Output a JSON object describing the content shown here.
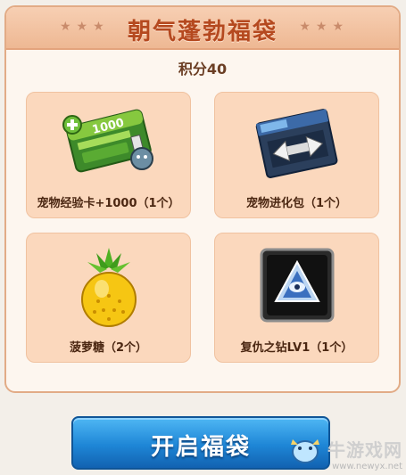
{
  "header": {
    "title": "朝气蓬勃福袋",
    "stars": "★★★"
  },
  "points_label": "积分40",
  "rewards": [
    {
      "label": "宠物经验卡+1000（1个）",
      "icon": "pet-exp-card-icon"
    },
    {
      "label": "宠物进化包（1个）",
      "icon": "pet-evolution-pack-icon"
    },
    {
      "label": "菠萝糖（2个）",
      "icon": "pineapple-candy-icon"
    },
    {
      "label": "复仇之钻LV1（1个）",
      "icon": "revenge-diamond-icon"
    }
  ],
  "card_art": {
    "exp_value": "1000"
  },
  "open_button": {
    "label": "开启福袋"
  },
  "watermark": {
    "brand": "牛游戏网",
    "url": "www.newyx.net"
  },
  "colors": {
    "title": "#b5491f",
    "card_bg": "#fbd8bd",
    "button": "#1e86d6"
  }
}
